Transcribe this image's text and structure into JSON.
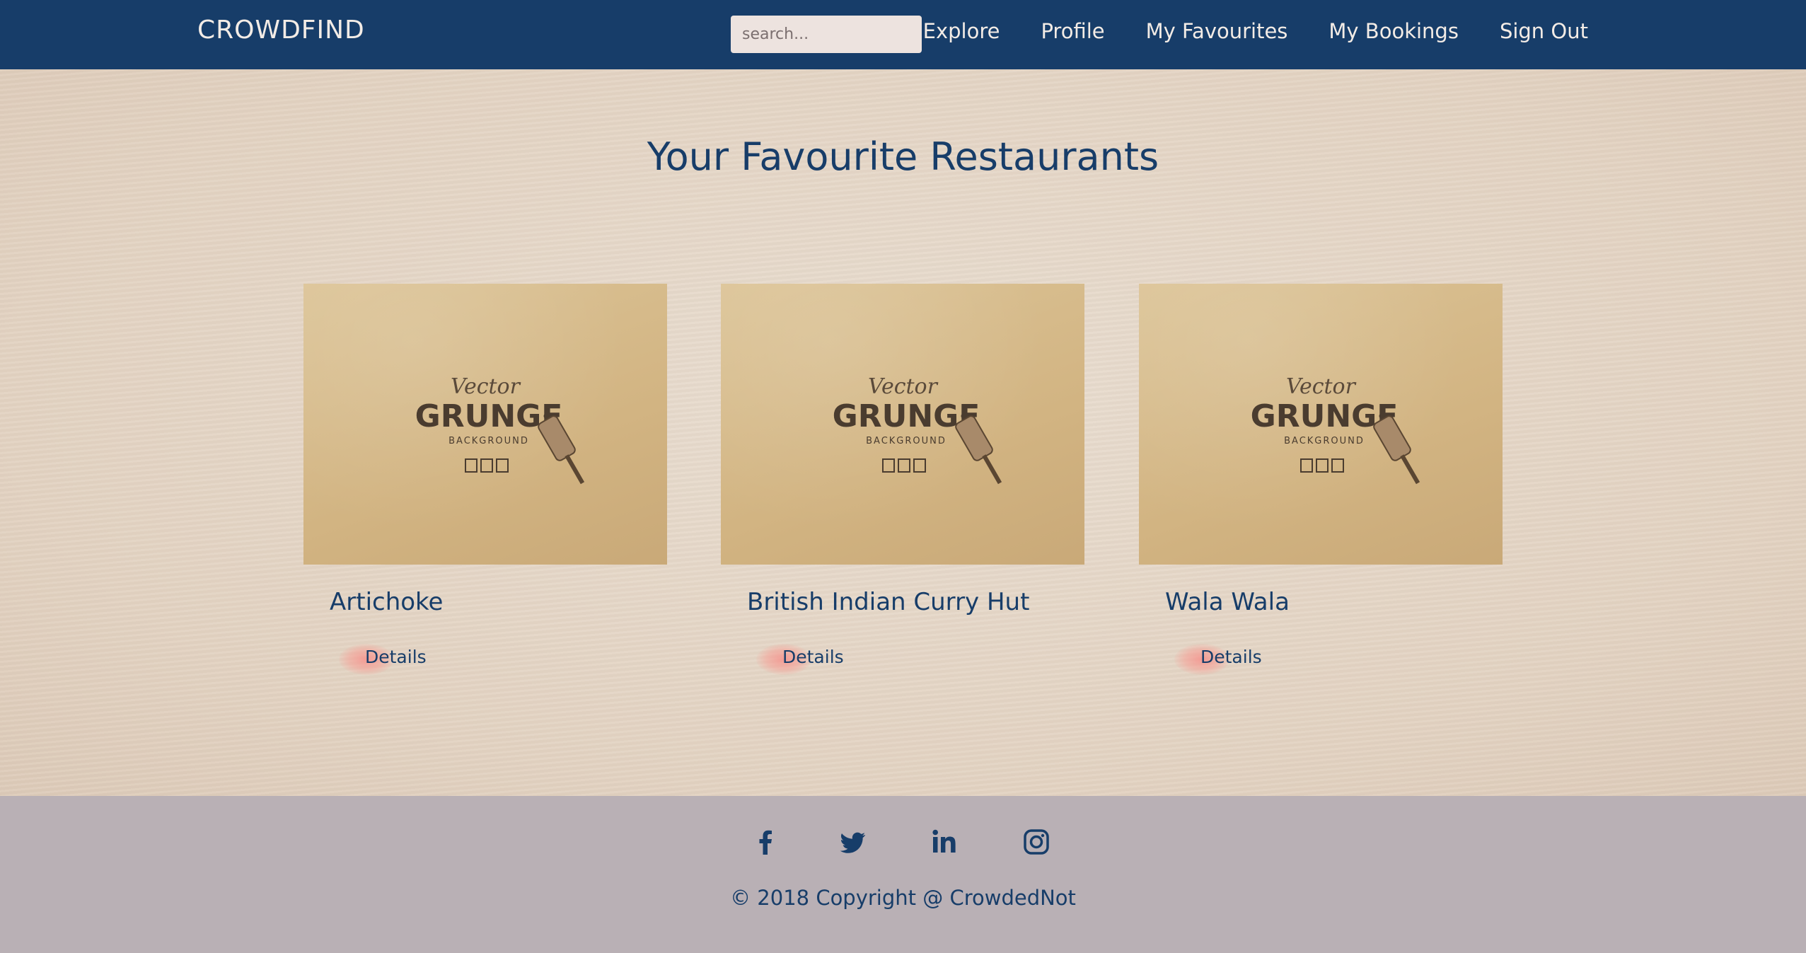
{
  "navbar": {
    "brand": "CROWDFIND",
    "search_placeholder": "search...",
    "links": [
      "Explore",
      "Profile",
      "My Favourites",
      "My Bookings",
      "Sign Out"
    ]
  },
  "main": {
    "title": "Your Favourite Restaurants",
    "cards": [
      {
        "name": "Artichoke",
        "button": "Details",
        "image": {
          "line1": "Vector",
          "line2": "GRUNGE",
          "line3": "BACKGROUND"
        }
      },
      {
        "name": "British Indian Curry Hut",
        "button": "Details",
        "image": {
          "line1": "Vector",
          "line2": "GRUNGE",
          "line3": "BACKGROUND"
        }
      },
      {
        "name": "Wala Wala",
        "button": "Details",
        "image": {
          "line1": "Vector",
          "line2": "GRUNGE",
          "line3": "BACKGROUND"
        }
      }
    ]
  },
  "footer": {
    "social": [
      "facebook-icon",
      "twitter-icon",
      "linkedin-icon",
      "instagram-icon"
    ],
    "copyright": "© 2018 Copyright @  CrowdedNot"
  },
  "colors": {
    "navbar": "#173d69",
    "accent_text": "#173d69",
    "footer": "#b9b0b5",
    "page_bg": "#e5d6c6",
    "details_splash": "#f6928c"
  }
}
